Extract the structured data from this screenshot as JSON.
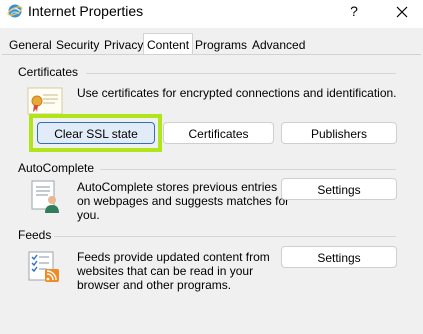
{
  "window": {
    "title": "Internet Properties",
    "help_glyph": "?",
    "close_glyph": "✕"
  },
  "tabs": [
    {
      "label": "General"
    },
    {
      "label": "Security"
    },
    {
      "label": "Privacy"
    },
    {
      "label": "Content",
      "active": true
    },
    {
      "label": "Programs"
    },
    {
      "label": "Advanced"
    }
  ],
  "certificates": {
    "section_title": "Certificates",
    "description": "Use certificates for encrypted connections and identification.",
    "clear_ssl_label": "Clear SSL state",
    "certificates_label": "Certificates",
    "publishers_label": "Publishers"
  },
  "autocomplete": {
    "section_title": "AutoComplete",
    "description_line1": "AutoComplete stores previous entries",
    "description_line2": "on webpages and suggests matches for",
    "description_line3": "you.",
    "settings_label": "Settings"
  },
  "feeds": {
    "section_title": "Feeds",
    "description_line1": "Feeds provide updated content from",
    "description_line2": "websites that can be read in your",
    "description_line3": "browser and other programs.",
    "settings_label": "Settings"
  },
  "colors": {
    "focus_highlight": "#b0e51c",
    "selected_button_border": "#2f6fc2",
    "selected_button_fill": "#e1ecf8",
    "rss_orange": "#f08a24"
  }
}
